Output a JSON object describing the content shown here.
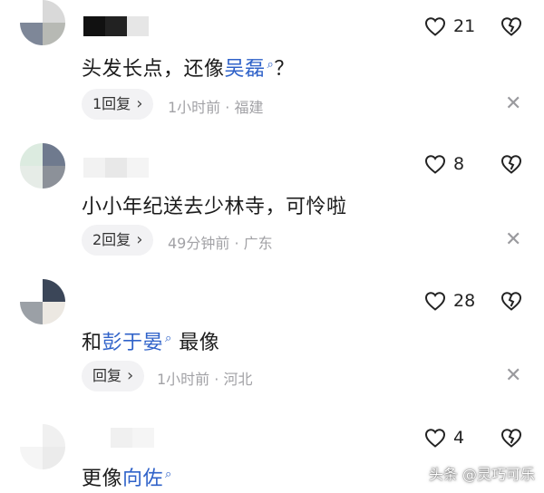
{
  "comments": [
    {
      "prefix": "头发长点，还像",
      "mention": "吴磊",
      "suffix": "？",
      "reply_label": "1回复",
      "meta": "1小时前 · 福建",
      "likes": "21"
    },
    {
      "prefix": "小小年纪送去少林寺，可怜啦",
      "mention": "",
      "suffix": "",
      "reply_label": "2回复",
      "meta": "49分钟前 · 广东",
      "likes": "8"
    },
    {
      "prefix": "和",
      "mention": "彭于晏",
      "suffix": " 最像",
      "reply_label": "回复",
      "meta": "1小时前 · 河北",
      "likes": "28"
    },
    {
      "prefix": "更像",
      "mention": "向佐",
      "suffix": "",
      "likes": "4"
    }
  ],
  "icons": {
    "like": "heart-outline-icon",
    "dislike": "broken-heart-icon",
    "close": "close-icon",
    "search": "search-icon",
    "chevron": "chevron-right-icon"
  },
  "colors": {
    "mention": "#2f62c9",
    "meta": "#a2a2a6",
    "reply_bg": "#f2f2f4"
  },
  "watermark": "头条 @灵巧可乐"
}
